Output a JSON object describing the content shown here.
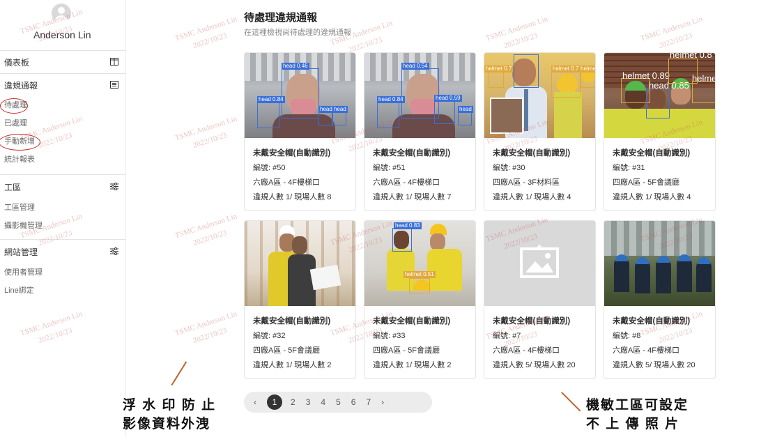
{
  "user": {
    "name": "Anderson Lin"
  },
  "sidebar": {
    "sections": [
      {
        "label": "儀表板",
        "icon": "columns-icon",
        "items": []
      },
      {
        "label": "違規通報",
        "icon": "list-icon",
        "items": [
          "待處理",
          "已處理",
          "手動新增",
          "統計報表"
        ]
      },
      {
        "label": "工區",
        "icon": "sliders-icon",
        "items": [
          "工區管理",
          "攝影機管理"
        ]
      },
      {
        "label": "網站管理",
        "icon": "sliders-icon",
        "items": [
          "使用者管理",
          "Line綁定"
        ]
      }
    ]
  },
  "main": {
    "title": "待處理違規通報",
    "subtitle": "在這裡檢視尚待處理的違規通報"
  },
  "cards": [
    {
      "title": "未戴安全帽(自動識別)",
      "id": "編號: #50",
      "location": "六廠A區 - 4F樓梯口",
      "counts": "違規人數 1/ 現場人數 8"
    },
    {
      "title": "未戴安全帽(自動識別)",
      "id": "編號: #51",
      "location": "六廠A區 - 4F樓梯口",
      "counts": "違規人數 1/ 現場人數 7"
    },
    {
      "title": "未戴安全帽(自動識別)",
      "id": "編號: #30",
      "location": "四廠A區 - 3F材料區",
      "counts": "違規人數 1/ 現場人數 4"
    },
    {
      "title": "未戴安全帽(自動識別)",
      "id": "編號: #31",
      "location": "四廠A區 - 5F會議廳",
      "counts": "違規人數 1/ 現場人數 4"
    },
    {
      "title": "未戴安全帽(自動識別)",
      "id": "編號: #32",
      "location": "四廠A區 - 5F會議廳",
      "counts": "違規人數 1/ 現場人數 2"
    },
    {
      "title": "未戴安全帽(自動識別)",
      "id": "編號: #33",
      "location": "四廠A區 - 5F會議廳",
      "counts": "違規人數 1/ 現場人數 2"
    },
    {
      "title": "未戴安全帽(自動識別)",
      "id": "編號: #7",
      "location": "六廠A區 - 4F樓梯口",
      "counts": "違規人數 5/ 現場人數 20"
    },
    {
      "title": "未戴安全帽(自動識別)",
      "id": "編號: #8",
      "location": "六廠A區 - 4F樓梯口",
      "counts": "違規人數 5/ 現場人數 20"
    }
  ],
  "detections": {
    "c0": [
      "head 0.46",
      "head 0.84",
      "head",
      "head"
    ],
    "c1": [
      "head 0.54",
      "head 0.84",
      "head 0.59",
      "head"
    ],
    "c2": [
      "helmet 0.7",
      "helmet 0.7",
      "helmet"
    ],
    "c3": [
      "helmet 0.89",
      "head 0.85",
      "helmet 0.8",
      "helme"
    ],
    "c5": [
      "head 0.83",
      "helmet 0.51"
    ]
  },
  "pagination": {
    "prev": "‹",
    "pages": [
      "1",
      "2",
      "3",
      "4",
      "5",
      "6",
      "7"
    ],
    "next": "›",
    "current": "1"
  },
  "watermark": {
    "line1": "TSMC Anderson Lin",
    "line2": "2022/10/23"
  },
  "annotations": {
    "left_line1": "浮 水 印 防 止",
    "left_line2": "影像資料外洩",
    "right_line1": "機敏工區可設定",
    "right_line2": "不 上 傳 照 片"
  },
  "colors": {
    "highlight_circle": "#c62828",
    "arrow": "#c0622b",
    "head_box": "#3a6fd8",
    "helmet_box": "#e2a93a"
  }
}
